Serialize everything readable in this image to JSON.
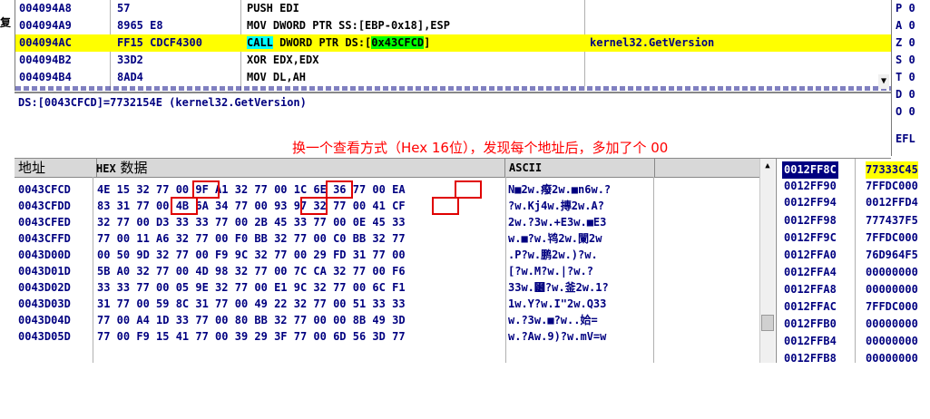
{
  "left_sliver": {
    "char": "复"
  },
  "disasm": {
    "rows": [
      {
        "addr": "004094A8",
        "hex": "57",
        "cmd": "PUSH EDI",
        "comment": ""
      },
      {
        "addr": "004094A9",
        "hex": "8965 E8",
        "cmd": "MOV DWORD PTR SS:[EBP-0x18],ESP",
        "comment": ""
      },
      {
        "addr": "004094AC",
        "hex": "FF15 CDCF4300",
        "cmd_call": "CALL",
        "cmd_mid": " DWORD PTR DS:[",
        "cmd_addr": "0x43CFCD",
        "cmd_end": "]",
        "comment": "kernel32.GetVersion"
      },
      {
        "addr": "004094B2",
        "hex": "33D2",
        "cmd": "XOR EDX,EDX",
        "comment": ""
      },
      {
        "addr": "004094B4",
        "hex": "8AD4",
        "cmd": "MOV DL,AH",
        "comment": ""
      }
    ]
  },
  "registers": {
    "flags": [
      "P 0",
      "A 0",
      "Z 0",
      "S 0",
      "T 0",
      "D 0",
      "O 0",
      "",
      "EFL"
    ]
  },
  "info": {
    "line": "DS:[0043CFCD]=7732154E (kernel32.GetVersion)",
    "annotation": "换一个查看方式（Hex 16位），发现每个地址后，多加了个 00"
  },
  "dump": {
    "headers": {
      "address": "地址",
      "hex_prefix": "HEX",
      "hex_suffix": "数据",
      "ascii": "ASCII"
    },
    "rows": [
      {
        "addr": "0043CFCD",
        "hex": "4E 15 32 77 00 9F A1 32 77 00 1C 6E 36 77 00 EA",
        "ascii": "N■2w.癈2w.■n6w.?"
      },
      {
        "addr": "0043CFDD",
        "hex": "83 31 77 00 4B 6A 34 77 00 93 97 32 77 00 41 CF",
        "ascii": "?w.Kj4w.摶2w.A?"
      },
      {
        "addr": "0043CFED",
        "hex": "32 77 00 D3 33 33 77 00 2B 45 33 77 00 0E 45 33",
        "ascii": "2w.?3w.+E3w.■E3"
      },
      {
        "addr": "0043CFFD",
        "hex": "77 00 11 A6 32 77 00 F0 BB 32 77 00 C0 BB 32 77",
        "ascii": "w.■?w.鸨2w.闌2w"
      },
      {
        "addr": "0043D00D",
        "hex": "00 50 9D 32 77 00 F9 9C 32 77 00 29 FD 31 77 00",
        "ascii": ".P?w.鹏2w.)?w."
      },
      {
        "addr": "0043D01D",
        "hex": "5B A0 32 77 00 4D 98 32 77 00 7C CA 32 77 00 F6",
        "ascii": "[?w.M?w.|?w.?"
      },
      {
        "addr": "0043D02D",
        "hex": "33 33 77 00 05 9E 32 77 00 E1 9C 32 77 00 6C F1",
        "ascii": "33w.⹶?w.釜2w.1?"
      },
      {
        "addr": "0043D03D",
        "hex": "31 77 00 59 8C 31 77 00 49 22 32 77 00 51 33 33",
        "ascii": "1w.Y?w.I\"2w.Q33"
      },
      {
        "addr": "0043D04D",
        "hex": "77 00 A4 1D 33 77 00 80 BB 32 77 00 00 8B 49 3D",
        "ascii": "w.?3w.■?w..姶="
      },
      {
        "addr": "0043D05D",
        "hex": "77 00 F9 15 41 77 00 39 29 3F 77 00 6D 56 3D 77",
        "ascii": "w.?Aw.9)?w.mV=w"
      }
    ]
  },
  "stack": {
    "rows": [
      {
        "addr": "0012FF8C",
        "val": "77333C45"
      },
      {
        "addr": "0012FF90",
        "val": "7FFDC000"
      },
      {
        "addr": "0012FF94",
        "val": "0012FFD4"
      },
      {
        "addr": "0012FF98",
        "val": "777437F5"
      },
      {
        "addr": "0012FF9C",
        "val": "7FFDC000"
      },
      {
        "addr": "0012FFA0",
        "val": "76D964F5"
      },
      {
        "addr": "0012FFA4",
        "val": "00000000"
      },
      {
        "addr": "0012FFA8",
        "val": "00000000"
      },
      {
        "addr": "0012FFAC",
        "val": "7FFDC000"
      },
      {
        "addr": "0012FFB0",
        "val": "00000000"
      },
      {
        "addr": "0012FFB4",
        "val": "00000000"
      },
      {
        "addr": "0012FFB8",
        "val": "00000000"
      }
    ]
  },
  "colors": {
    "code_text": "#000080",
    "highlight": "#ffff00",
    "call": "#00ffff",
    "operand": "#00ff00",
    "annotation": "#ff0000",
    "box": "#e00000"
  }
}
